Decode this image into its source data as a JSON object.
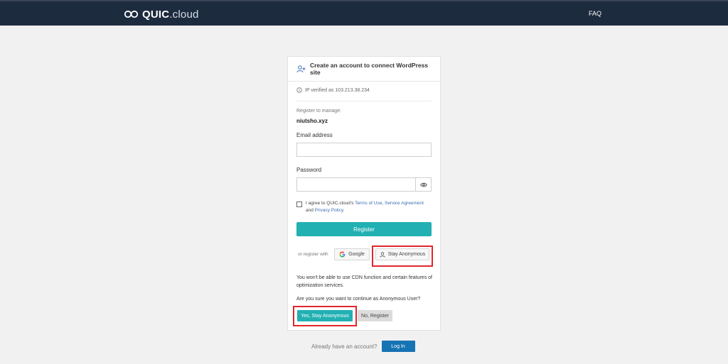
{
  "header": {
    "logo_strong": "QUIC",
    "logo_light": ".cloud",
    "faq_label": "FAQ"
  },
  "card": {
    "title": "Create an account to connect WordPress site",
    "ip_verified": "IP verified as 103.213.38.234",
    "register_to_manage_label": "Register to manage:",
    "domain": "niutsho.xyz",
    "email_label": "Email address",
    "email_value": "",
    "password_label": "Password",
    "password_value": "",
    "agree_prefix": "I agree to QUIC.cloud's",
    "terms_link": "Terms of Use",
    "comma": ",",
    "service_link": "Service Agreement",
    "and_text": "and",
    "privacy_link": "Privacy Policy",
    "period": ".",
    "register_button": "Register",
    "or_register_with": "or register with",
    "google_button": "Google",
    "stay_anonymous_button": "Stay Anonymous",
    "warning_text": "You won't be able to use CDN function and certain features of optimization services.",
    "confirm_question": "Are you sure you want to continue as Anonymous User?",
    "yes_button": "Yes, Stay Anonymous",
    "no_button": "No, Register"
  },
  "footer": {
    "already_text": "Already have an account?",
    "login_button": "Log In"
  },
  "colors": {
    "topbar": "#1d2b3f",
    "accent_teal": "#22b0b2",
    "login_blue": "#1673b4",
    "highlight_red": "#e0262c",
    "link_blue": "#3b6fb6"
  },
  "icons": [
    "quic-cloud-logo-icon",
    "add-user-icon",
    "info-icon",
    "eye-icon",
    "google-icon",
    "user-icon"
  ]
}
